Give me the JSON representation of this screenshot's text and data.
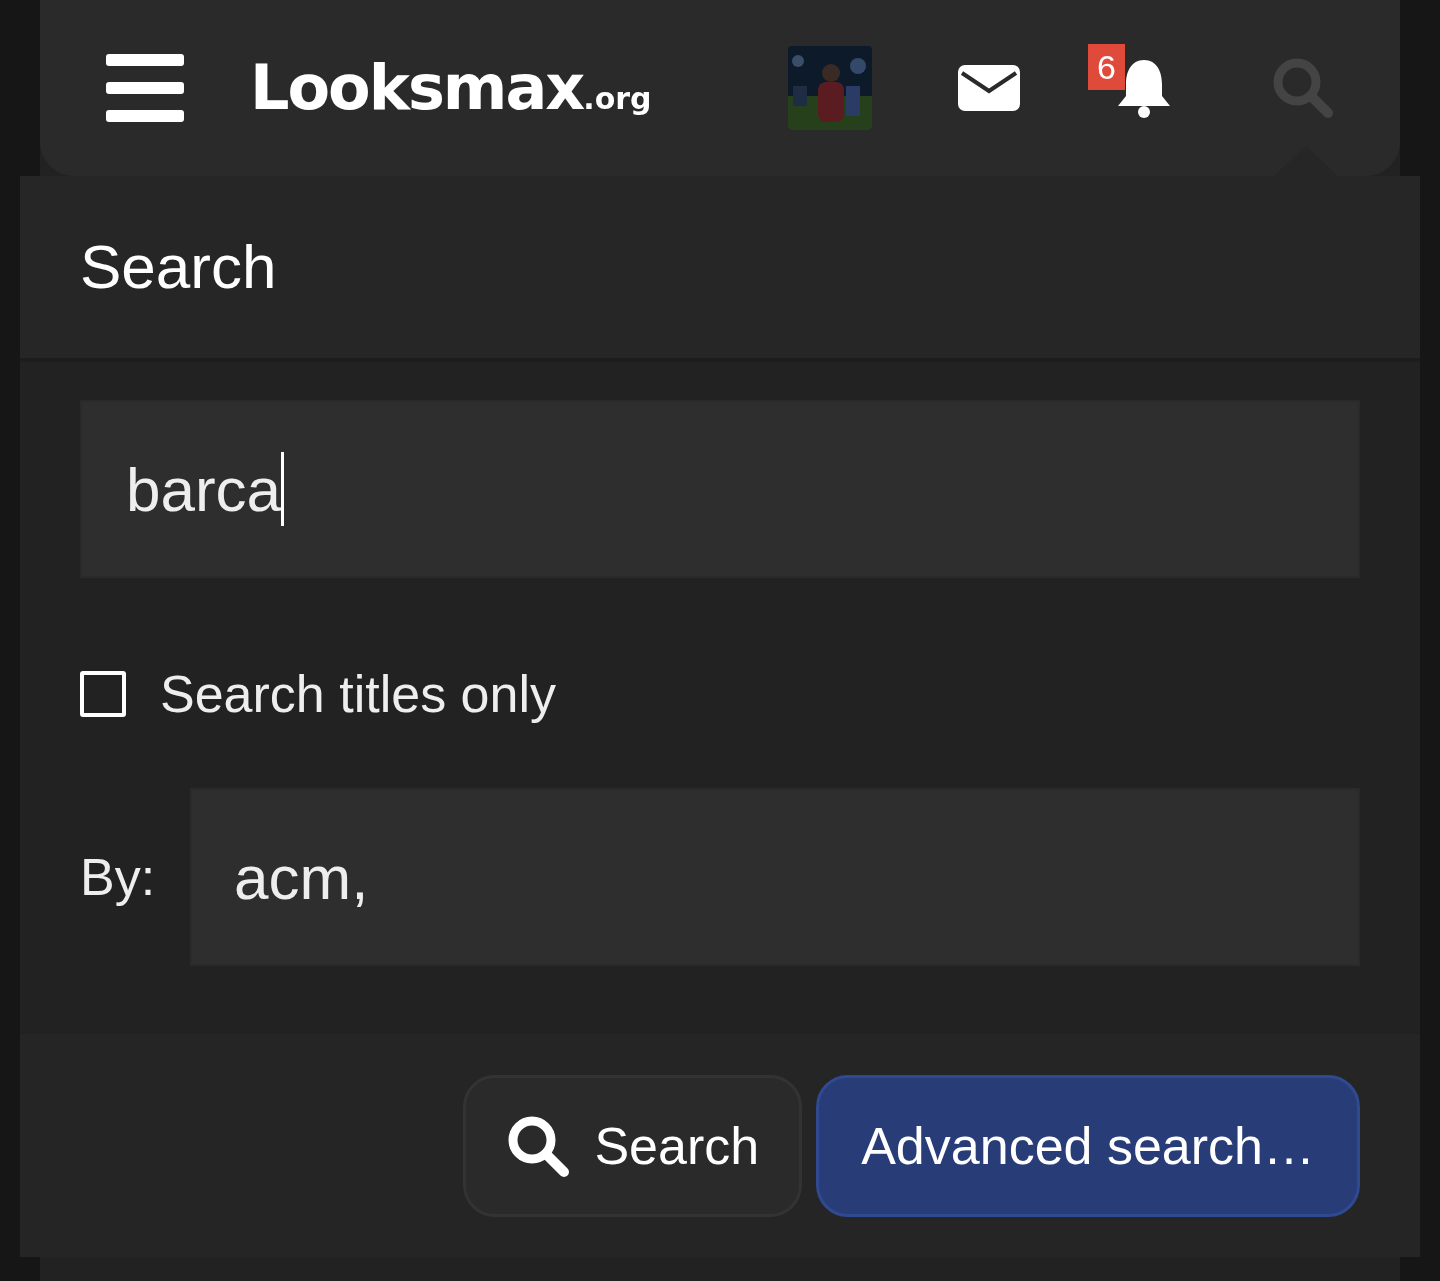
{
  "header": {
    "logo": {
      "name": "Looksmax",
      "suffix": ".org"
    },
    "notifications": {
      "badge": "6"
    }
  },
  "search_menu": {
    "title": "Search",
    "query": {
      "value": "barca",
      "focused": true
    },
    "options": [
      {
        "kind": "checkbox",
        "label": "Search titles only",
        "checked": false
      },
      {
        "kind": "field",
        "label": "By:",
        "value": "acm,"
      }
    ],
    "buttons": [
      {
        "label": "Search",
        "kind": "primary"
      },
      {
        "label": "Advanced search…",
        "kind": "accent"
      }
    ]
  }
}
